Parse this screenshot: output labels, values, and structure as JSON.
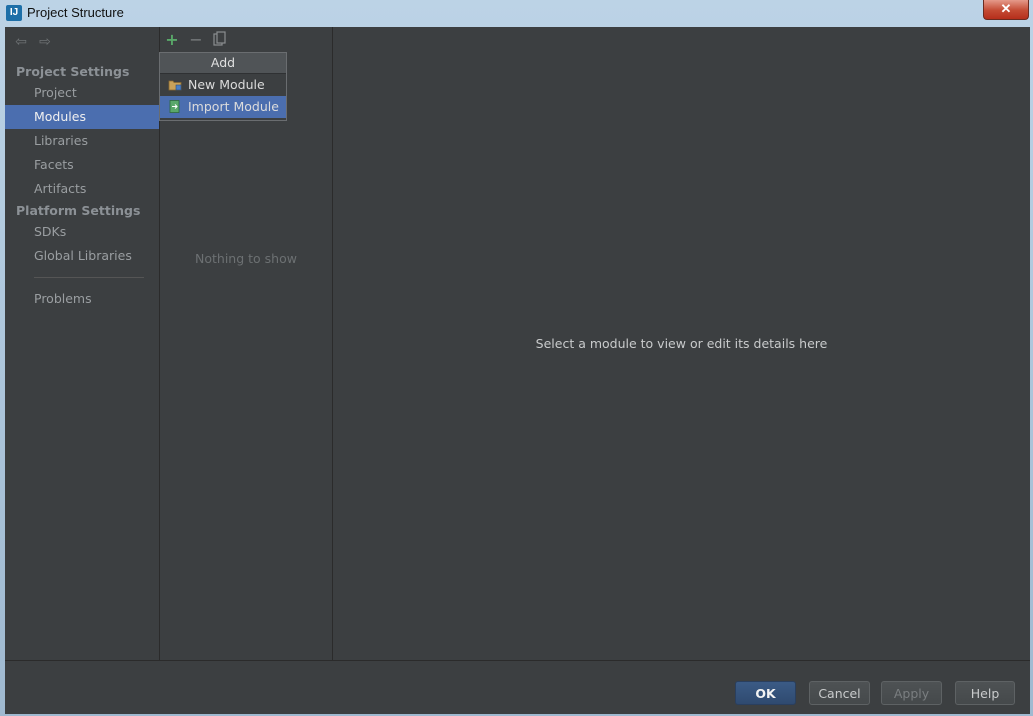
{
  "window": {
    "title": "Project Structure",
    "close_glyph": "✕"
  },
  "toolbar": {
    "back_glyph": "⇦",
    "forward_glyph": "⇨",
    "add_glyph": "+",
    "remove_glyph": "−",
    "copy_icon": "copy-icon"
  },
  "sidebar": {
    "project_settings_heading": "Project Settings",
    "project_items": [
      {
        "label": "Project"
      },
      {
        "label": "Modules",
        "selected": true
      },
      {
        "label": "Libraries"
      },
      {
        "label": "Facets"
      },
      {
        "label": "Artifacts"
      }
    ],
    "platform_settings_heading": "Platform Settings",
    "platform_items": [
      {
        "label": "SDKs"
      },
      {
        "label": "Global Libraries"
      }
    ],
    "problems_label": "Problems"
  },
  "popup": {
    "header": "Add",
    "items": [
      {
        "label": "New Module",
        "icon": "folder-module-icon"
      },
      {
        "label": "Import Module",
        "icon": "import-module-icon",
        "hovered": true
      }
    ]
  },
  "middle": {
    "empty_text": "Nothing to show"
  },
  "detail": {
    "message": "Select a module to view or edit its details here"
  },
  "buttons": {
    "ok": "OK",
    "cancel": "Cancel",
    "apply": "Apply",
    "help": "Help"
  },
  "colors": {
    "background": "#3c3f41",
    "selection": "#4b6eaf",
    "add_green": "#59a869"
  }
}
